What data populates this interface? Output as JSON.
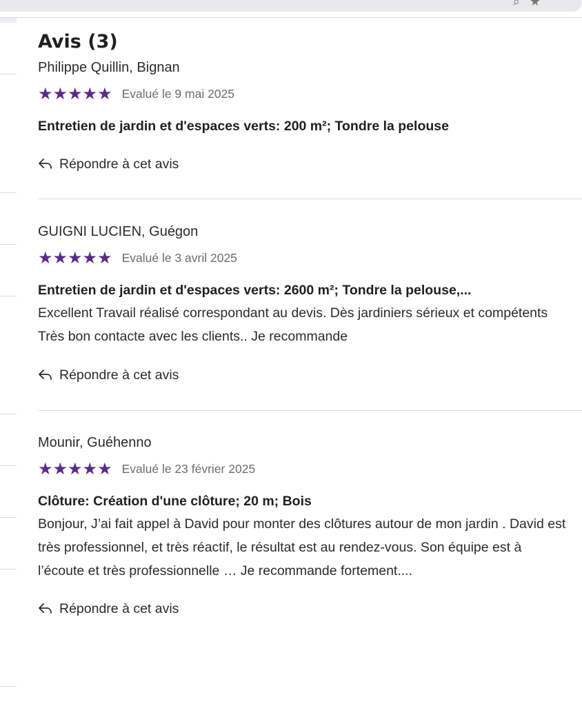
{
  "page": {
    "title": "Avis (3)"
  },
  "reviews": [
    {
      "reviewer": "Philippe Quillin, Bignan",
      "stars": "★★★★★",
      "date": "Evalué le 9 mai 2025",
      "service": "Entretien de jardin et d'espaces verts: 200 m²; Tondre la pelouse",
      "comment": "",
      "reply_label": "Répondre à cet avis"
    },
    {
      "reviewer": "GUIGNI LUCIEN, Guégon",
      "stars": "★★★★★",
      "date": "Evalué le 3 avril 2025",
      "service": "Entretien de jardin et d'espaces verts: 2600 m²; Tondre la pelouse,...",
      "comment": "Excellent Travail réalisé correspondant au devis. Dès jardiniers sérieux et compétents Très bon contacte avec les clients.. Je recommande",
      "reply_label": "Répondre à cet avis"
    },
    {
      "reviewer": "Mounir, Guéhenno",
      "stars": "★★★★★",
      "date": "Evalué le 23 février 2025",
      "service": "Clôture: Création d'une clôture; 20 m; Bois",
      "comment": "Bonjour, J’ai fait appel à David pour monter des clôtures autour de mon jardin . David est très professionnel, et très réactif, le résultat est au rendez-vous. Son équipe est à l’écoute et très professionnelle … Je recommande fortement....",
      "reply_label": "Répondre à cet avis"
    }
  ],
  "colors": {
    "star": "#5b2a86",
    "divider": "#dcdcdc"
  },
  "icons": {
    "reply": "reply-arrow-icon",
    "browser": [
      "search-icon",
      "star-icon"
    ]
  }
}
